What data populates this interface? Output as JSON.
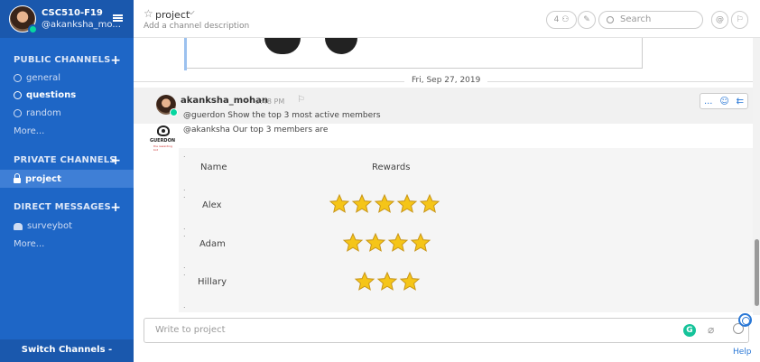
{
  "sidebar": {
    "team_name": "CSC510-F19",
    "user_handle": "@akanksha_mo...",
    "public_channels": {
      "title": "PUBLIC CHANNELS",
      "items": [
        {
          "label": "general"
        },
        {
          "label": "questions"
        },
        {
          "label": "random"
        },
        {
          "label": "More..."
        }
      ]
    },
    "private_channels": {
      "title": "PRIVATE CHANNELS",
      "items": [
        {
          "label": "project"
        }
      ]
    },
    "direct_messages": {
      "title": "DIRECT MESSAGES",
      "items": [
        {
          "label": "surveybot"
        },
        {
          "label": "More..."
        }
      ]
    },
    "switch_label": "Switch Channels - CTRL+K"
  },
  "header": {
    "channel_name": "project",
    "channel_description": "Add a channel description",
    "member_count": "4",
    "search_placeholder": "Search"
  },
  "chat": {
    "date_separator": "Fri, Sep 27, 2019",
    "message": {
      "user": "akanksha_mohan",
      "time": "3:48 PM",
      "text": "@guerdon Show the top 3 most active members",
      "actions": "..."
    },
    "bot": {
      "brand": "GUERDON",
      "tagline": "the rewarding bot",
      "intro": "@akanksha Our top 3 members are",
      "columns": {
        "name": "Name",
        "rewards": "Rewards"
      },
      "rows": [
        {
          "name": "Alex",
          "stars": 5
        },
        {
          "name": "Adam",
          "stars": 4
        },
        {
          "name": "Hillary",
          "stars": 3
        }
      ]
    }
  },
  "composer": {
    "placeholder": "Write to project",
    "grammarly": "G"
  },
  "help": {
    "label": "Help"
  },
  "colors": {
    "sidebar": "#1e66c6",
    "accent": "#2a78d6",
    "online": "#06d6a0",
    "star": "#f5c518"
  }
}
